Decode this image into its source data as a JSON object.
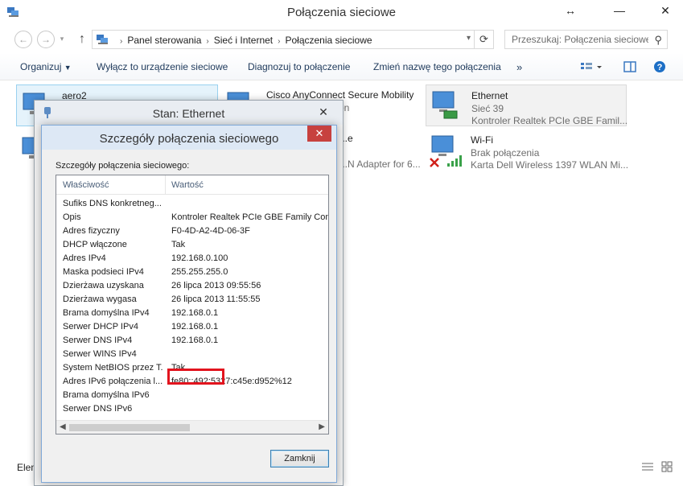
{
  "window": {
    "title": "Połączenia sieciowe",
    "restore_glyph": "↔",
    "minimize_glyph": "—",
    "close_glyph": "✕"
  },
  "address": {
    "crumbs": [
      "Panel sterowania",
      "Sieć i Internet",
      "Połączenia sieciowe"
    ],
    "search_placeholder": "Przeszukaj: Połączenia sieciowe"
  },
  "toolbar": {
    "organize": "Organizuj",
    "disable": "Wyłącz to urządzenie sieciowe",
    "diagnose": "Diagnozuj to połączenie",
    "rename": "Zmień nazwę tego połączenia",
    "more": "»"
  },
  "connections": [
    {
      "name": "aero2",
      "lines": []
    },
    {
      "name": "Cisco AnyConnect Secure Mobility",
      "lines": [
        "...on"
      ]
    },
    {
      "name": "Ethernet",
      "lines": [
        "Sieć  39",
        "Kontroler Realtek PCIe GBE Famil..."
      ]
    },
    {
      "name": "",
      "lines": [
        "...e",
        "...N Adapter for 6..."
      ]
    },
    {
      "name": "Wi-Fi",
      "lines": [
        "Brak połączenia",
        "Karta Dell Wireless 1397 WLAN Mi..."
      ]
    }
  ],
  "statusbar": {
    "count": "Elem"
  },
  "stan_dialog": {
    "title": "Stan: Ethernet",
    "close_glyph": "✕"
  },
  "details_dialog": {
    "title": "Szczegóły połączenia sieciowego",
    "group_label": "Szczegóły połączenia sieciowego:",
    "col_property": "Właściwość",
    "col_value": "Wartość",
    "rows": [
      {
        "p": "Sufiks DNS konkretneg...",
        "v": ""
      },
      {
        "p": "Opis",
        "v": "Kontroler Realtek PCIe GBE Family Contro"
      },
      {
        "p": "Adres fizyczny",
        "v": "F0-4D-A2-4D-06-3F"
      },
      {
        "p": "DHCP włączone",
        "v": "Tak"
      },
      {
        "p": "Adres IPv4",
        "v": "192.168.0.100"
      },
      {
        "p": "Maska podsieci IPv4",
        "v": "255.255.255.0"
      },
      {
        "p": "Dzierżawa uzyskana",
        "v": "26 lipca 2013 09:55:56"
      },
      {
        "p": "Dzierżawa wygasa",
        "v": "26 lipca 2013 11:55:55"
      },
      {
        "p": "Brama domyślna IPv4",
        "v": "192.168.0.1"
      },
      {
        "p": "Serwer DHCP IPv4",
        "v": "192.168.0.1"
      },
      {
        "p": "Serwer DNS IPv4",
        "v": "192.168.0.1"
      },
      {
        "p": "Serwer WINS IPv4",
        "v": ""
      },
      {
        "p": "System NetBIOS przez T...",
        "v": "Tak"
      },
      {
        "p": "Adres IPv6 połączenia l...",
        "v": "fe80::492:5327:c45e:d952%12"
      },
      {
        "p": "Brama domyślna IPv6",
        "v": ""
      },
      {
        "p": "Serwer DNS IPv6",
        "v": ""
      }
    ],
    "close_button": "Zamknij"
  },
  "colors": {
    "highlight": "#e2141e",
    "close_red": "#c7413f",
    "selection": "#e5f3fb"
  },
  "icons": [
    "network-connections-icon",
    "back-icon",
    "forward-icon",
    "up-icon",
    "refresh-icon",
    "search-icon",
    "view-options-icon",
    "preview-pane-icon",
    "help-icon",
    "network-adapter-icon",
    "wifi-signal-icon",
    "disconnected-x-icon"
  ]
}
